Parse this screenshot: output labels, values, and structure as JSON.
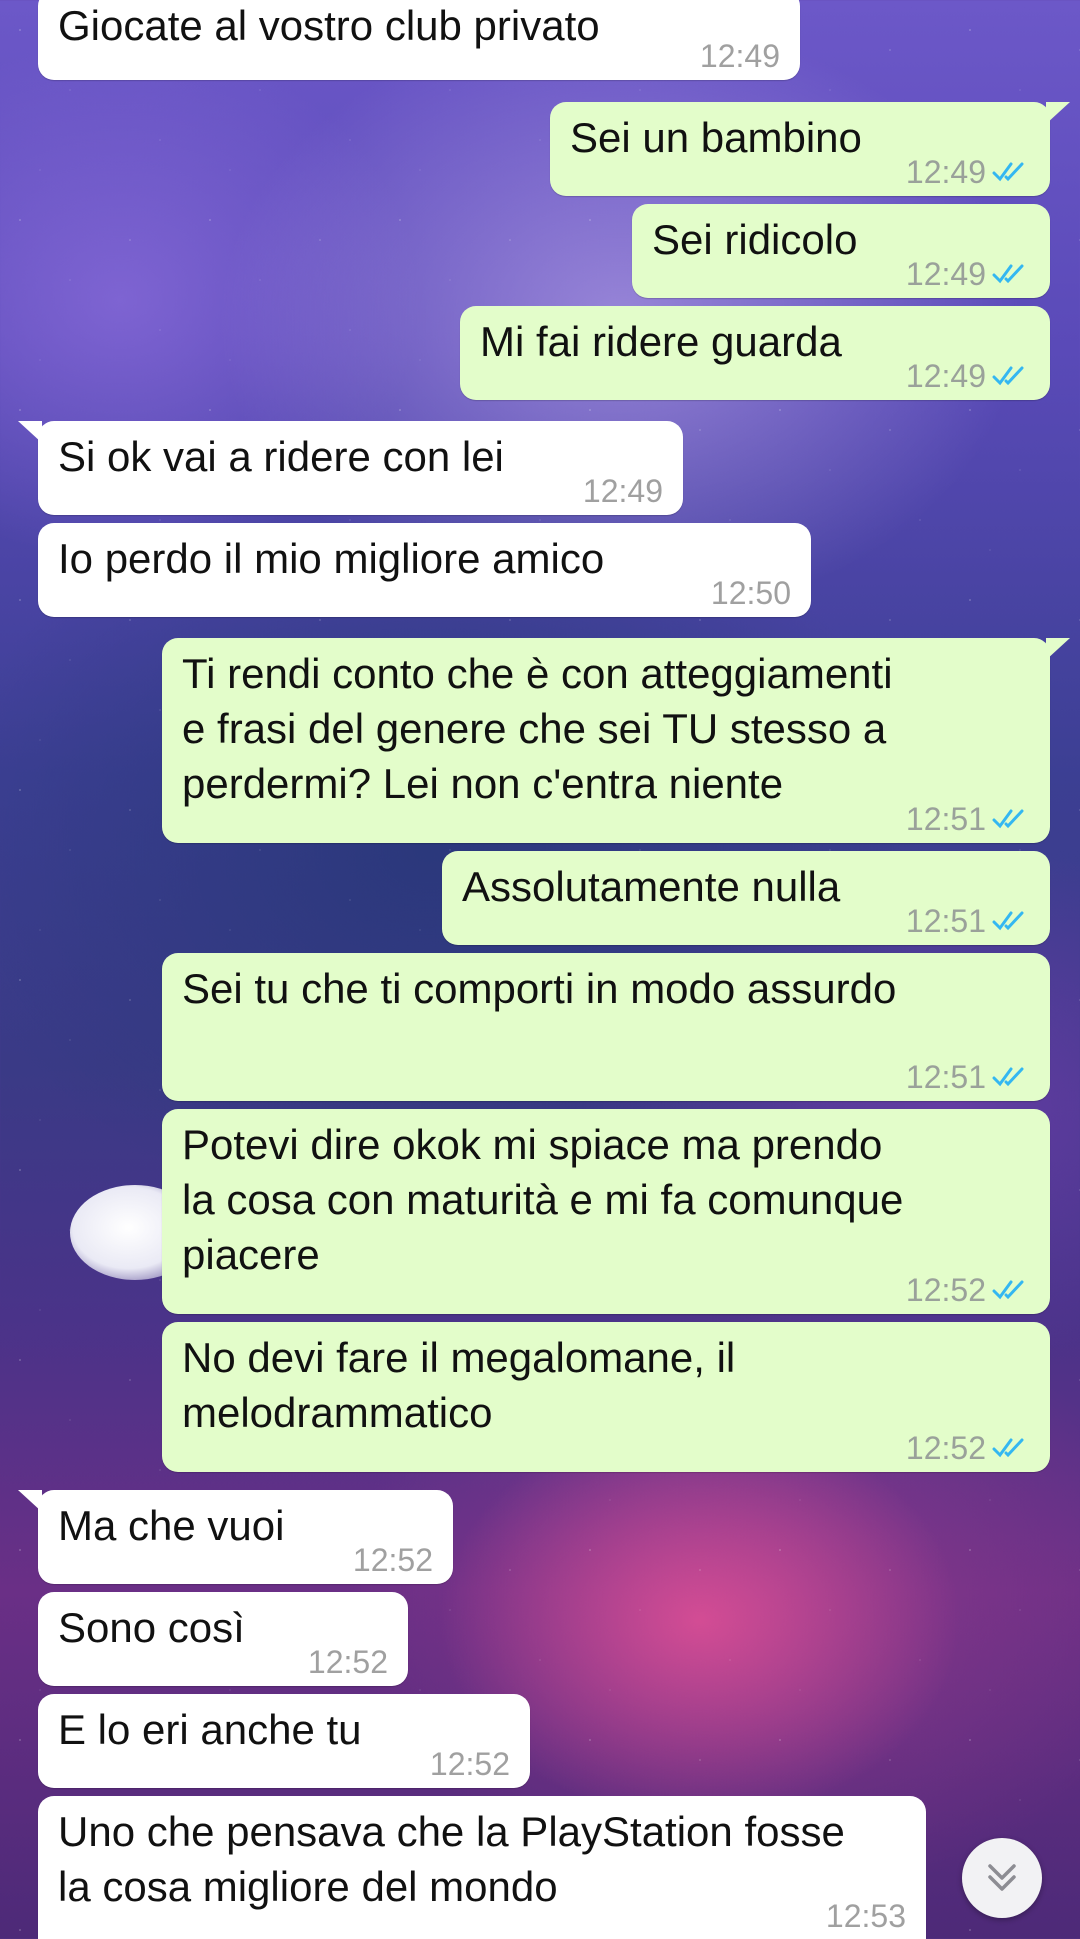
{
  "chat": {
    "messages": [
      {
        "dir": "in",
        "text": "Giocate al vostro club privato",
        "time": "12:49"
      },
      {
        "dir": "out",
        "text": "Sei un bambino",
        "time": "12:49"
      },
      {
        "dir": "out",
        "text": "Sei ridicolo",
        "time": "12:49"
      },
      {
        "dir": "out",
        "text": "Mi fai ridere guarda",
        "time": "12:49"
      },
      {
        "dir": "in",
        "text": "Si ok vai a ridere con lei",
        "time": "12:49"
      },
      {
        "dir": "in",
        "text": "Io perdo il mio migliore amico",
        "time": "12:50"
      },
      {
        "dir": "out",
        "text": "Ti rendi conto che è con atteggiamenti\ne frasi del genere che sei TU stesso a\nperdermi? Lei non c'entra niente",
        "time": "12:51"
      },
      {
        "dir": "out",
        "text": "Assolutamente nulla",
        "time": "12:51"
      },
      {
        "dir": "out",
        "text": "Sei tu che ti comporti in modo assurdo",
        "time": "12:51"
      },
      {
        "dir": "out",
        "text": "Potevi dire okok mi spiace ma prendo\nla cosa con maturità e mi fa comunque\npiacere",
        "time": "12:52"
      },
      {
        "dir": "out",
        "text": "No devi fare il megalomane, il\nmelodrammatico",
        "time": "12:52"
      },
      {
        "dir": "in",
        "text": "Ma che vuoi",
        "time": "12:52"
      },
      {
        "dir": "in",
        "text": "Sono così",
        "time": "12:52"
      },
      {
        "dir": "in",
        "text": "E lo eri anche tu",
        "time": "12:52"
      },
      {
        "dir": "in",
        "text": "Uno che pensava che la PlayStation fosse\nla cosa migliore del mondo",
        "time": "12:53"
      }
    ],
    "read_status": "read",
    "read_check_color": "#34b7f1",
    "scroll_button_icon": "double-chevron-down-icon"
  }
}
